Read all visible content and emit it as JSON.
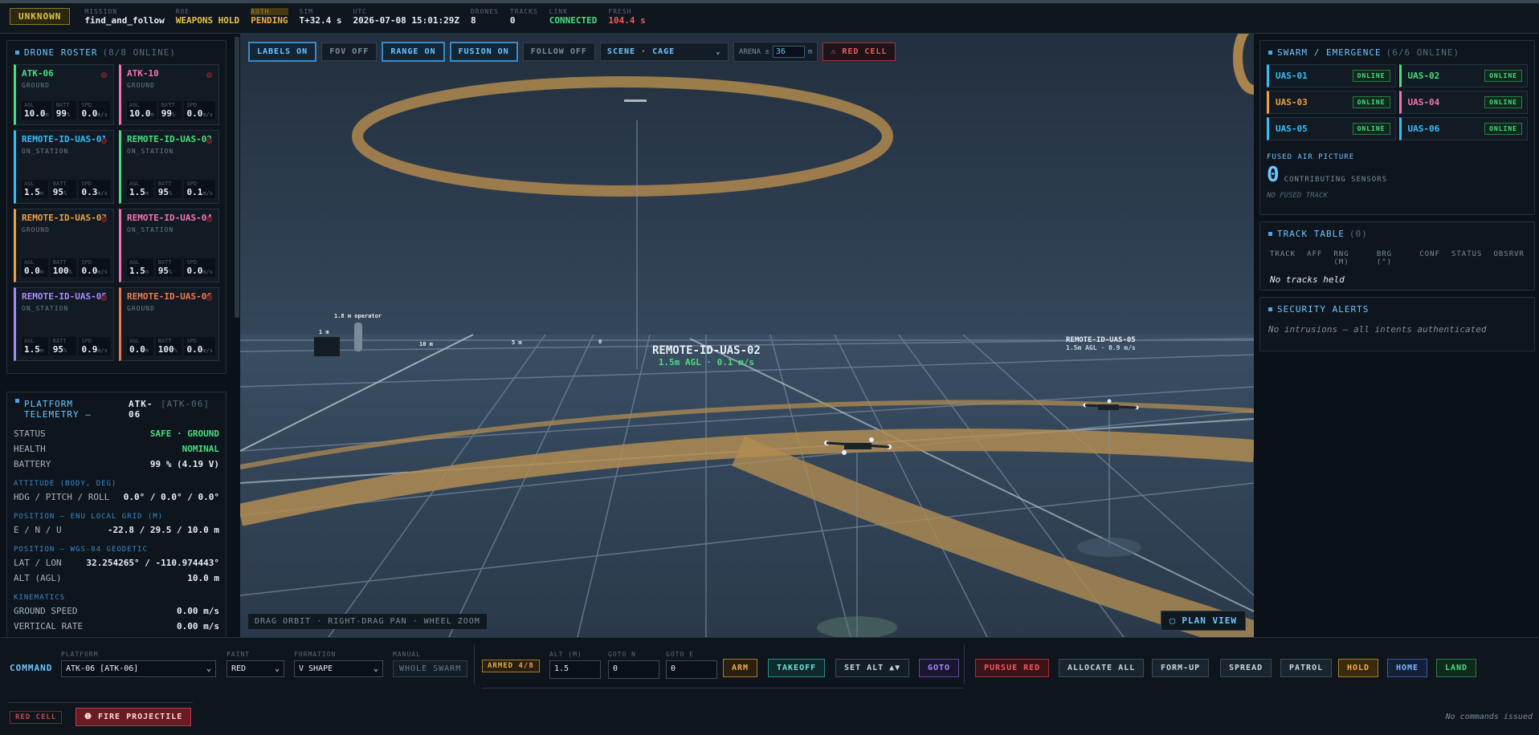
{
  "topbar": {
    "classification": "UNKNOWN",
    "mission_label": "MISSION",
    "mission": "find_and_follow",
    "roe_label": "ROE",
    "roe": "WEAPONS HOLD",
    "auth_label": "AUTH",
    "auth": "PENDING",
    "sim_label": "SIM",
    "sim": "T+32.4 s",
    "utc_label": "UTC",
    "utc": "2026-07-08 15:01:29Z",
    "drones_label": "DRONES",
    "drones": "8",
    "tracks_label": "TRACKS",
    "tracks": "0",
    "link_label": "LINK",
    "link": "CONNECTED",
    "fresh_label": "FRESH",
    "fresh": "104.4 s"
  },
  "roster": {
    "title": "DRONE ROSTER",
    "count": "(8/8 ONLINE)",
    "stat_labels": {
      "agl": "AGL",
      "batt": "BATT",
      "spd": "SPD"
    },
    "units": {
      "m": "m",
      "pct": "%",
      "ms": "m/s"
    },
    "drones": [
      {
        "name": "ATK-06",
        "state": "GROUND",
        "agl": "10.0",
        "batt": "99",
        "spd": "0.0",
        "color": "#4ade80"
      },
      {
        "name": "ATK-10",
        "state": "GROUND",
        "agl": "10.0",
        "batt": "99",
        "spd": "0.0",
        "color": "#f472b6"
      },
      {
        "name": "REMOTE-ID-UAS-01",
        "state": "ON_STATION",
        "agl": "1.5",
        "batt": "95",
        "spd": "0.3",
        "color": "#38bdf8"
      },
      {
        "name": "REMOTE-ID-UAS-02",
        "state": "ON_STATION",
        "agl": "1.5",
        "batt": "95",
        "spd": "0.1",
        "color": "#4ade80"
      },
      {
        "name": "REMOTE-ID-UAS-03",
        "state": "GROUND",
        "agl": "0.0",
        "batt": "100",
        "spd": "0.0",
        "color": "#f0a040"
      },
      {
        "name": "REMOTE-ID-UAS-04",
        "state": "ON_STATION",
        "agl": "1.5",
        "batt": "95",
        "spd": "0.0",
        "color": "#f472b6"
      },
      {
        "name": "REMOTE-ID-UAS-05",
        "state": "ON_STATION",
        "agl": "1.5",
        "batt": "95",
        "spd": "0.9",
        "color": "#a78bfa"
      },
      {
        "name": "REMOTE-ID-UAS-06",
        "state": "GROUND",
        "agl": "0.0",
        "batt": "100",
        "spd": "0.0",
        "color": "#f07850"
      }
    ]
  },
  "telemetry": {
    "title": "PLATFORM TELEMETRY —",
    "callsign": "ATK-06",
    "id": "[ATK-06]",
    "status_k": "STATUS",
    "status_v": "SAFE · GROUND",
    "health_k": "HEALTH",
    "health_v": "NOMINAL",
    "battery_k": "BATTERY",
    "battery_v": "99 % (4.19 V)",
    "att_sec": "ATTITUDE (BODY, DEG)",
    "hpr_k": "HDG / PITCH / ROLL",
    "hpr_v": "0.0° / 0.0° / 0.0°",
    "enu_sec": "POSITION — ENU LOCAL GRID (M)",
    "enu_k": "E / N / U",
    "enu_v": "-22.8 / 29.5 / 10.0 m",
    "wgs_sec": "POSITION — WGS-84 GEODETIC",
    "latlon_k": "LAT / LON",
    "latlon_v": "32.254265° / -110.974443°",
    "alt_k": "ALT (AGL)",
    "alt_v": "10.0 m",
    "kin_sec": "KINEMATICS",
    "gs_k": "GROUND SPEED",
    "gs_v": "0.00 m/s",
    "vr_k": "VERTICAL RATE",
    "vr_v": "0.00 m/s"
  },
  "viewport": {
    "labels": "LABELS ON",
    "fov": "FOV OFF",
    "range": "RANGE ON",
    "fusion": "FUSION ON",
    "follow": "FOLLOW OFF",
    "scene": "SCENE · CAGE",
    "arena_label": "ARENA ±",
    "arena_value": "36",
    "arena_unit": "m",
    "red_cell": "RED CELL",
    "hint": "DRAG ORBIT · RIGHT-DRAG PAN · WHEEL ZOOM",
    "plan_view": "PLAN VIEW",
    "label_uas02": "REMOTE-ID-UAS-02",
    "label_uas02_sub": "1.5m AGL · 0.1 m/s",
    "label_uas05": "REMOTE-ID-UAS-05",
    "label_uas05_sub": "1.5m AGL · 0.9 m/s",
    "operator": "1.8 m operator",
    "mark_1m": "1 m",
    "mark_10m": "10 m",
    "mark_5m": "5 m",
    "mark_0": "0"
  },
  "swarm": {
    "title": "SWARM / EMERGENCE",
    "count": "(6/6 ONLINE)",
    "online": "ONLINE",
    "units": [
      {
        "name": "UAS-01",
        "color": "#38bdf8"
      },
      {
        "name": "UAS-02",
        "color": "#4ade80"
      },
      {
        "name": "UAS-03",
        "color": "#f0a040"
      },
      {
        "name": "UAS-04",
        "color": "#f472b6"
      },
      {
        "name": "UAS-05",
        "color": "#38bdf8"
      },
      {
        "name": "UAS-06",
        "color": "#38bdf8"
      }
    ],
    "fused_title": "FUSED AIR PICTURE",
    "fused_count": "0",
    "contrib": "CONTRIBUTING SENSORS",
    "no_fused": "NO FUSED TRACK"
  },
  "tracks": {
    "title": "TRACK TABLE",
    "count": "(0)",
    "cols": [
      "TRACK",
      "AFF",
      "RNG (M)",
      "BRG (°)",
      "CONF",
      "STATUS",
      "OBSRVR"
    ],
    "empty": "No tracks held"
  },
  "alerts": {
    "title": "SECURITY ALERTS",
    "msg": "No intrusions — all intents authenticated"
  },
  "command": {
    "label": "COMMAND",
    "platform_label": "PLATFORM",
    "platform": "ATK-06 [ATK-06]",
    "paint_label": "PAINT",
    "paint": "RED",
    "formation_label": "FORMATION",
    "formation": "V SHAPE",
    "manual_label": "MANUAL",
    "whole_swarm": "WHOLE SWARM",
    "armed": "ARMED 4/8",
    "alt_label": "ALT (M)",
    "alt": "1.5",
    "goton_label": "GOTO N",
    "goton": "0",
    "gotoe_label": "GOTO E",
    "gotoe": "0",
    "arm": "ARM",
    "takeoff": "TAKEOFF",
    "set_alt": "SET ALT ▲▼",
    "goto": "GOTO",
    "pursue": "PURSUE RED",
    "allocate": "ALLOCATE ALL",
    "formup": "FORM-UP",
    "spread": "SPREAD",
    "patrol": "PATROL",
    "hold": "HOLD",
    "home": "HOME",
    "land": "LAND",
    "red_cell": "RED CELL",
    "fire": "FIRE PROJECTILE",
    "no_cmds": "No commands issued"
  }
}
